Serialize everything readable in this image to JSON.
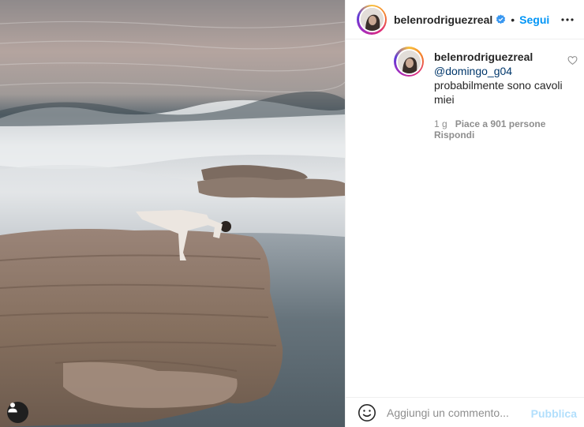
{
  "post": {
    "image_alt": "",
    "user_tag_icon": "user-silhouette-icon"
  },
  "header": {
    "username": "belenrodriguezreal",
    "verified_icon": "verified-badge-icon",
    "separator": "•",
    "follow_label": "Segui",
    "more_icon": "more-horizontal-icon"
  },
  "comment": {
    "username": "belenrodriguezreal",
    "mention": "@domingo_g04",
    "text": "probabilmente sono cavoli miei",
    "time": "1 g",
    "likes": "Piace a 901 persone",
    "reply_label": "Rispondi",
    "like_icon": "heart-outline-icon"
  },
  "composer": {
    "emoji_icon": "emoji-smile-icon",
    "placeholder": "Aggiungi un commento...",
    "publish_label": "Pubblica"
  },
  "colors": {
    "follow": "#0095f6",
    "publish_disabled": "#b2dffc",
    "mention": "#00376b"
  }
}
